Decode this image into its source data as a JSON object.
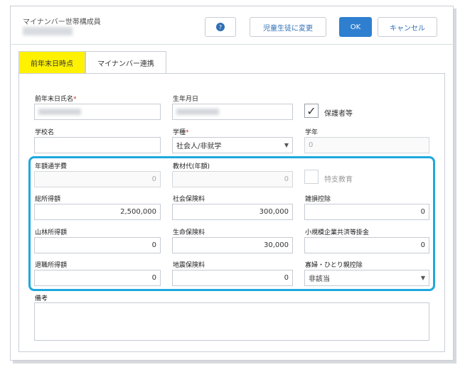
{
  "header": {
    "title": "マイナンバー世帯構成員",
    "buttons": {
      "help": "?",
      "change": "児童生徒に変更",
      "ok": "OK",
      "cancel": "キャンセル"
    }
  },
  "tabs": [
    {
      "label": "前年末日時点"
    },
    {
      "label": "マイナンバー連携"
    }
  ],
  "form": {
    "name_label": "前年末日氏名",
    "birthday_label": "生年月日",
    "guardian_label": "保護者等",
    "school_label": "学校名",
    "type_label": "学種",
    "type_value": "社会人/非就学",
    "grade_label": "学年",
    "grade_value": "0",
    "tuition_label": "年額通学費",
    "tuition_value": "0",
    "material_label": "教材代(年額)",
    "material_value": "0",
    "special_label": "特支教育",
    "total_income_label": "総所得額",
    "total_income_value": "2,500,000",
    "social_label": "社会保険料",
    "social_value": "300,000",
    "misc_loss_label": "雑損控除",
    "misc_loss_value": "0",
    "forest_label": "山林所得額",
    "forest_value": "0",
    "life_label": "生命保険料",
    "life_value": "30,000",
    "small_biz_label": "小規模企業共済等掛金",
    "small_biz_value": "0",
    "retire_label": "退職所得額",
    "retire_value": "0",
    "quake_label": "地震保険料",
    "quake_value": "0",
    "widow_label": "寡婦・ひとり親控除",
    "widow_value": "非該当",
    "notes_label": "備考"
  }
}
